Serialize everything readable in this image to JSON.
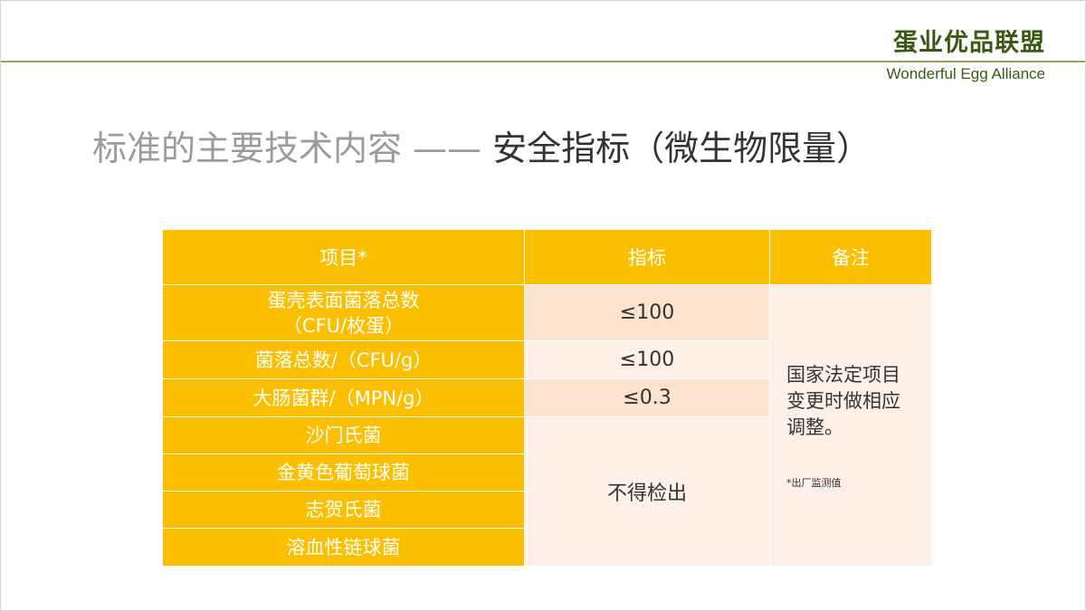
{
  "header": {
    "brand_cn": "蛋业优品联盟",
    "brand_en": "Wonderful Egg Alliance"
  },
  "title": {
    "prefix": "标准的主要技术内容 —— ",
    "main": "安全指标（微生物限量）"
  },
  "table": {
    "headers": [
      "项目*",
      "指标",
      "备注"
    ],
    "rows": [
      {
        "item_line1": "蛋壳表面菌落总数",
        "item_line2": "（CFU/枚蛋）",
        "value": "≤100"
      },
      {
        "item": "菌落总数/（CFU/g）",
        "value": "≤100"
      },
      {
        "item": "大肠菌群/（MPN/g）",
        "value": "≤0.3"
      },
      {
        "item": "沙门氏菌"
      },
      {
        "item": "金黄色葡萄球菌"
      },
      {
        "item": "志贺氏菌"
      },
      {
        "item": "溶血性链球菌"
      }
    ],
    "merged_value": "不得检出",
    "note_main": "国家法定项目变更时做相应调整。",
    "note_sub": "*出厂监测值"
  },
  "colors": {
    "header_fill": "#fcbf00",
    "cell_light": "#fdf0e6",
    "cell_mid": "#fbe3cd",
    "brand": "#3a5a14",
    "rule": "#8fa64a"
  }
}
